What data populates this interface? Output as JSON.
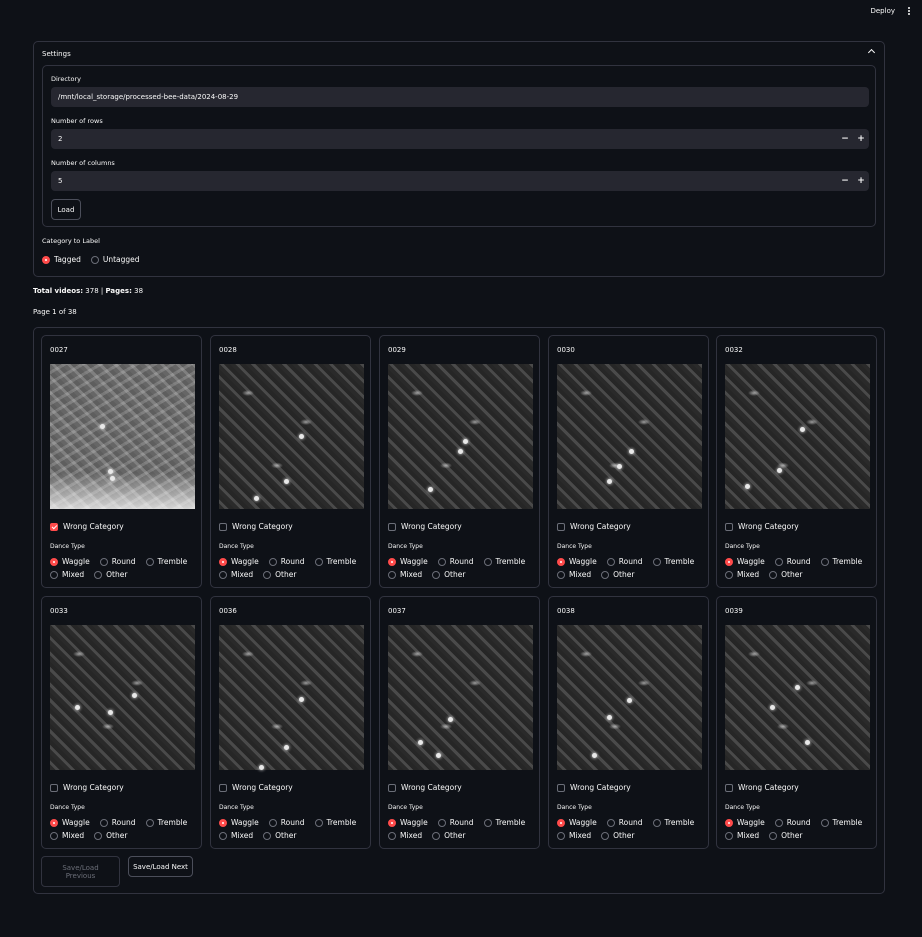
{
  "header": {
    "deploy_label": "Deploy"
  },
  "settings": {
    "title": "Settings",
    "directory_label": "Directory",
    "directory_value": "/mnt/local_storage/processed-bee-data/2024-08-29",
    "rows_label": "Number of rows",
    "rows_value": "2",
    "cols_label": "Number of columns",
    "cols_value": "5",
    "minus": "−",
    "plus": "+",
    "load_label": "Load",
    "category_label": "Category to Label",
    "category_options": [
      "Tagged",
      "Untagged"
    ],
    "category_selected": "Tagged"
  },
  "summary": {
    "total_label": "Total videos:",
    "total_value": "378 |",
    "pages_label": "Pages:",
    "pages_value": "38",
    "page_info": "Page 1 of 38"
  },
  "labels": {
    "wrong_category": "Wrong Category",
    "dance_type": "Dance Type",
    "waggle": "Waggle",
    "round": "Round",
    "tremble": "Tremble",
    "mixed": "Mixed",
    "other": "Other"
  },
  "cards": [
    {
      "id": "0027",
      "wrong": true,
      "selected": "Waggle"
    },
    {
      "id": "0028",
      "wrong": false,
      "selected": "Waggle"
    },
    {
      "id": "0029",
      "wrong": false,
      "selected": "Waggle"
    },
    {
      "id": "0030",
      "wrong": false,
      "selected": "Waggle"
    },
    {
      "id": "0032",
      "wrong": false,
      "selected": "Waggle"
    },
    {
      "id": "0033",
      "wrong": false,
      "selected": "Waggle"
    },
    {
      "id": "0036",
      "wrong": false,
      "selected": "Waggle"
    },
    {
      "id": "0037",
      "wrong": false,
      "selected": "Waggle"
    },
    {
      "id": "0038",
      "wrong": false,
      "selected": "Waggle"
    },
    {
      "id": "0039",
      "wrong": false,
      "selected": "Waggle"
    }
  ],
  "nav": {
    "prev_label_line1": "Save/Load",
    "prev_label_line2": "Previous",
    "next_label": "Save/Load Next"
  },
  "colors": {
    "accent": "#ff4b4b",
    "background": "#0e1117",
    "input": "#262730",
    "border": "#31333f"
  }
}
